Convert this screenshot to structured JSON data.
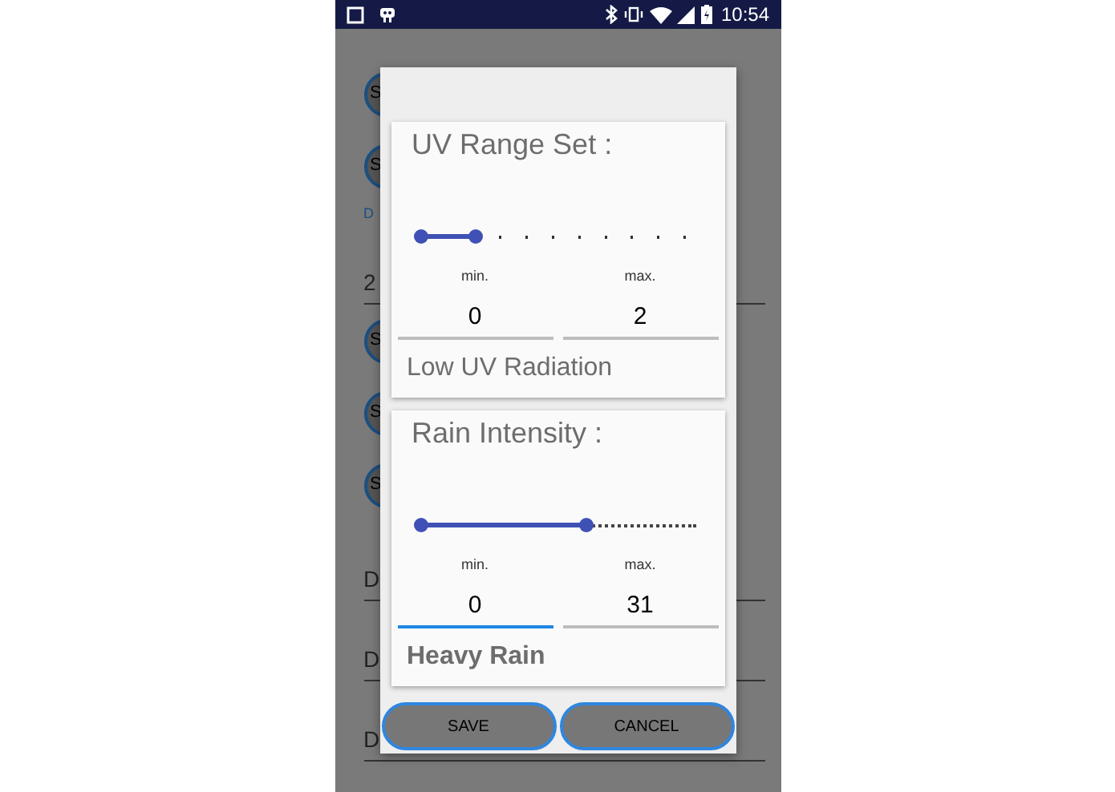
{
  "status_bar": {
    "time": "10:54"
  },
  "background": [
    {
      "kind": "circle",
      "text": "S"
    },
    {
      "kind": "circle",
      "text": "S"
    },
    {
      "kind": "label",
      "text": "D"
    },
    {
      "kind": "field",
      "text": "2"
    },
    {
      "kind": "circle",
      "text": "S"
    },
    {
      "kind": "circle",
      "text": "S"
    },
    {
      "kind": "circle",
      "text": "S"
    },
    {
      "kind": "field",
      "text": "D"
    },
    {
      "kind": "field",
      "text": "D"
    },
    {
      "kind": "field",
      "text": "D"
    }
  ],
  "dialog": {
    "cards": [
      {
        "title": "UV Range Set :",
        "slider": {
          "kind": "discrete",
          "level": 0.2
        },
        "min_label": "min.",
        "max_label": "max.",
        "min": {
          "value": "0",
          "focused": false
        },
        "max": {
          "value": "2",
          "focused": false
        },
        "description": "Low UV Radiation",
        "bold": false
      },
      {
        "title": "Rain Intensity :",
        "slider": {
          "kind": "continuous",
          "level": 0.6
        },
        "min_label": "min.",
        "max_label": "max.",
        "min": {
          "value": "0",
          "focused": true
        },
        "max": {
          "value": "31",
          "focused": false
        },
        "description": "Heavy Rain",
        "bold": true
      }
    ],
    "buttons": [
      "SAVE",
      "CANCEL"
    ]
  }
}
